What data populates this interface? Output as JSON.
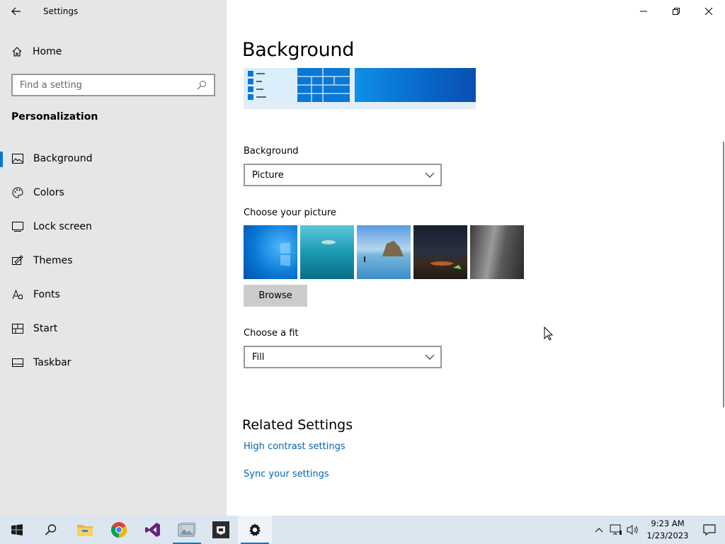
{
  "app": {
    "title": "Settings"
  },
  "sidebar": {
    "home_label": "Home",
    "search_placeholder": "Find a setting",
    "section_title": "Personalization",
    "items": [
      {
        "label": "Background",
        "icon": "picture-icon",
        "active": true
      },
      {
        "label": "Colors",
        "icon": "palette-icon"
      },
      {
        "label": "Lock screen",
        "icon": "lock-screen-icon"
      },
      {
        "label": "Themes",
        "icon": "themes-icon"
      },
      {
        "label": "Fonts",
        "icon": "fonts-icon"
      },
      {
        "label": "Start",
        "icon": "start-icon"
      },
      {
        "label": "Taskbar",
        "icon": "taskbar-icon"
      }
    ]
  },
  "main": {
    "page_title": "Background",
    "background_label": "Background",
    "background_value": "Picture",
    "choose_picture_label": "Choose your picture",
    "browse_label": "Browse",
    "fit_label": "Choose a fit",
    "fit_value": "Fill",
    "related_title": "Related Settings",
    "links": [
      "High contrast settings",
      "Sync your settings"
    ]
  },
  "taskbar": {
    "apps": [
      "start-icon",
      "search-icon",
      "file-explorer-icon",
      "chrome-icon",
      "visual-studio-icon",
      "photos-icon",
      "app-icon",
      "settings-gear-icon"
    ],
    "time": "9:23 AM",
    "date": "1/23/2023"
  },
  "colors": {
    "accent": "#0078d7",
    "link": "#0063b1",
    "sidebar_bg": "#e6e6e6",
    "taskbar_bg": "#dce6f0"
  }
}
